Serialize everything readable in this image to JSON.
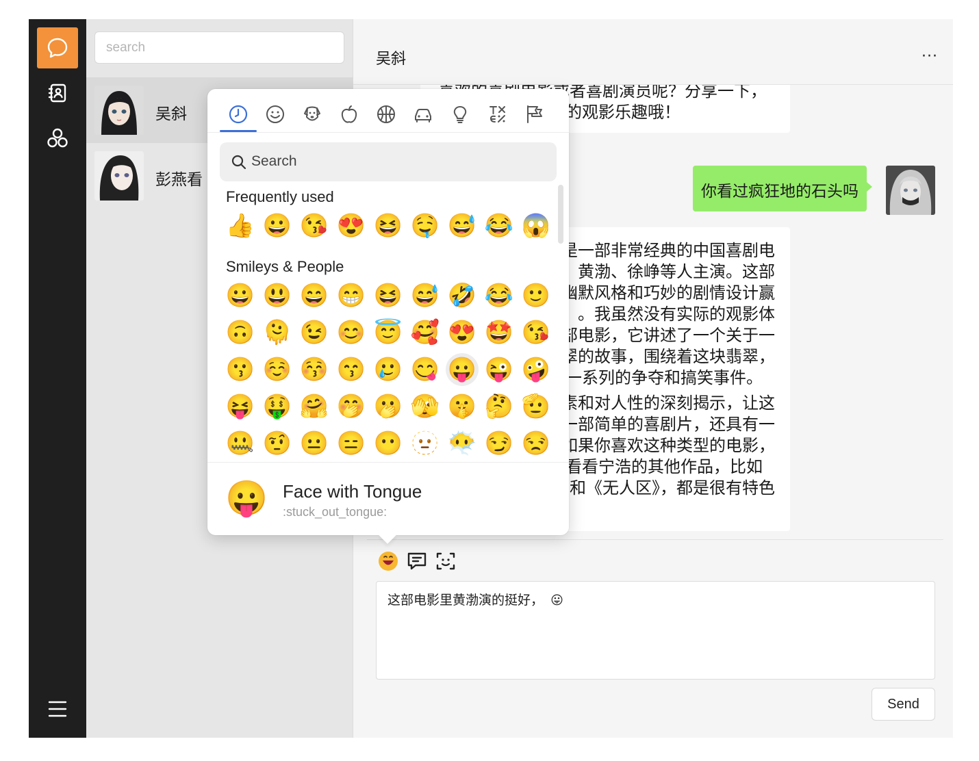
{
  "rail": {
    "items": [
      {
        "icon": "chat-bubble-icon",
        "active": true
      },
      {
        "icon": "contacts-book-icon",
        "active": false
      },
      {
        "icon": "circles-icon",
        "active": false
      }
    ],
    "menu_icon": "hamburger-menu-icon"
  },
  "contacts": {
    "search_placeholder": "search",
    "list": [
      {
        "name": "吴斜",
        "selected": true
      },
      {
        "name": "彭燕看",
        "selected": false
      }
    ]
  },
  "chat": {
    "title": "吴斜",
    "more": "···",
    "messages": {
      "m1_lines": [
        "喜欢的喜剧电影或者喜剧演员呢？分享一下，",
        "的观影乐趣哦！"
      ],
      "m2_text": "你看过疯狂地的石头吗",
      "m3_lines": [
        "是一部非常经典的中国喜剧电",
        "、黄渤、徐峥等人主演。这部",
        "幽默风格和巧妙的剧情设计赢",
        "。我虽然没有实际的观影体",
        "部电影，它讲述了一个关于一",
        "翠的故事，围绕着这块翡翠，",
        "一系列的争夺和搞笑事件。",
        "素和对人性的深刻揭示，让这",
        "一部简单的喜剧片，还具有一",
        "如果你喜欢这种类型的电影，",
        "看看宁浩的其他作品，比如",
        "和《无人区》，都是很有特色"
      ]
    },
    "toolbar": [
      "emoji-button-icon",
      "message-square-icon",
      "scan-icon"
    ],
    "composer_text": "这部电影里黄渤演的挺好，",
    "composer_emoji": "😛",
    "send_label": "Send"
  },
  "emoji_picker": {
    "categories": [
      "clock-icon",
      "smiley-icon",
      "dog-icon",
      "apple-icon",
      "basketball-icon",
      "car-icon",
      "lightbulb-icon",
      "symbols-icon",
      "flags-icon"
    ],
    "search_placeholder": "Search",
    "frequently_used_title": "Frequently used",
    "frequently_used": [
      "👍",
      "😀",
      "😘",
      "😍",
      "😆",
      "🤤",
      "😅",
      "😂",
      "😱"
    ],
    "smileys_title": "Smileys & People",
    "smileys": [
      "😀",
      "😃",
      "😄",
      "😁",
      "😆",
      "😅",
      "🤣",
      "😂",
      "🙂",
      "🙃",
      "🫠",
      "😉",
      "😊",
      "😇",
      "🥰",
      "😍",
      "🤩",
      "😘",
      "😗",
      "☺️",
      "😚",
      "😙",
      "🥲",
      "😋",
      "😛",
      "😜",
      "🤪",
      "😝",
      "🤑",
      "🤗",
      "🤭",
      "🫢",
      "🫣",
      "🤫",
      "🤔",
      "🫡",
      "🤐",
      "🤨",
      "😐",
      "😑",
      "😶",
      "🫥",
      "😶‍🌫️",
      "😏",
      "😒"
    ],
    "hovered_index": 24,
    "preview": {
      "emoji": "😛",
      "name": "Face with Tongue",
      "code": ":stuck_out_tongue:"
    }
  }
}
